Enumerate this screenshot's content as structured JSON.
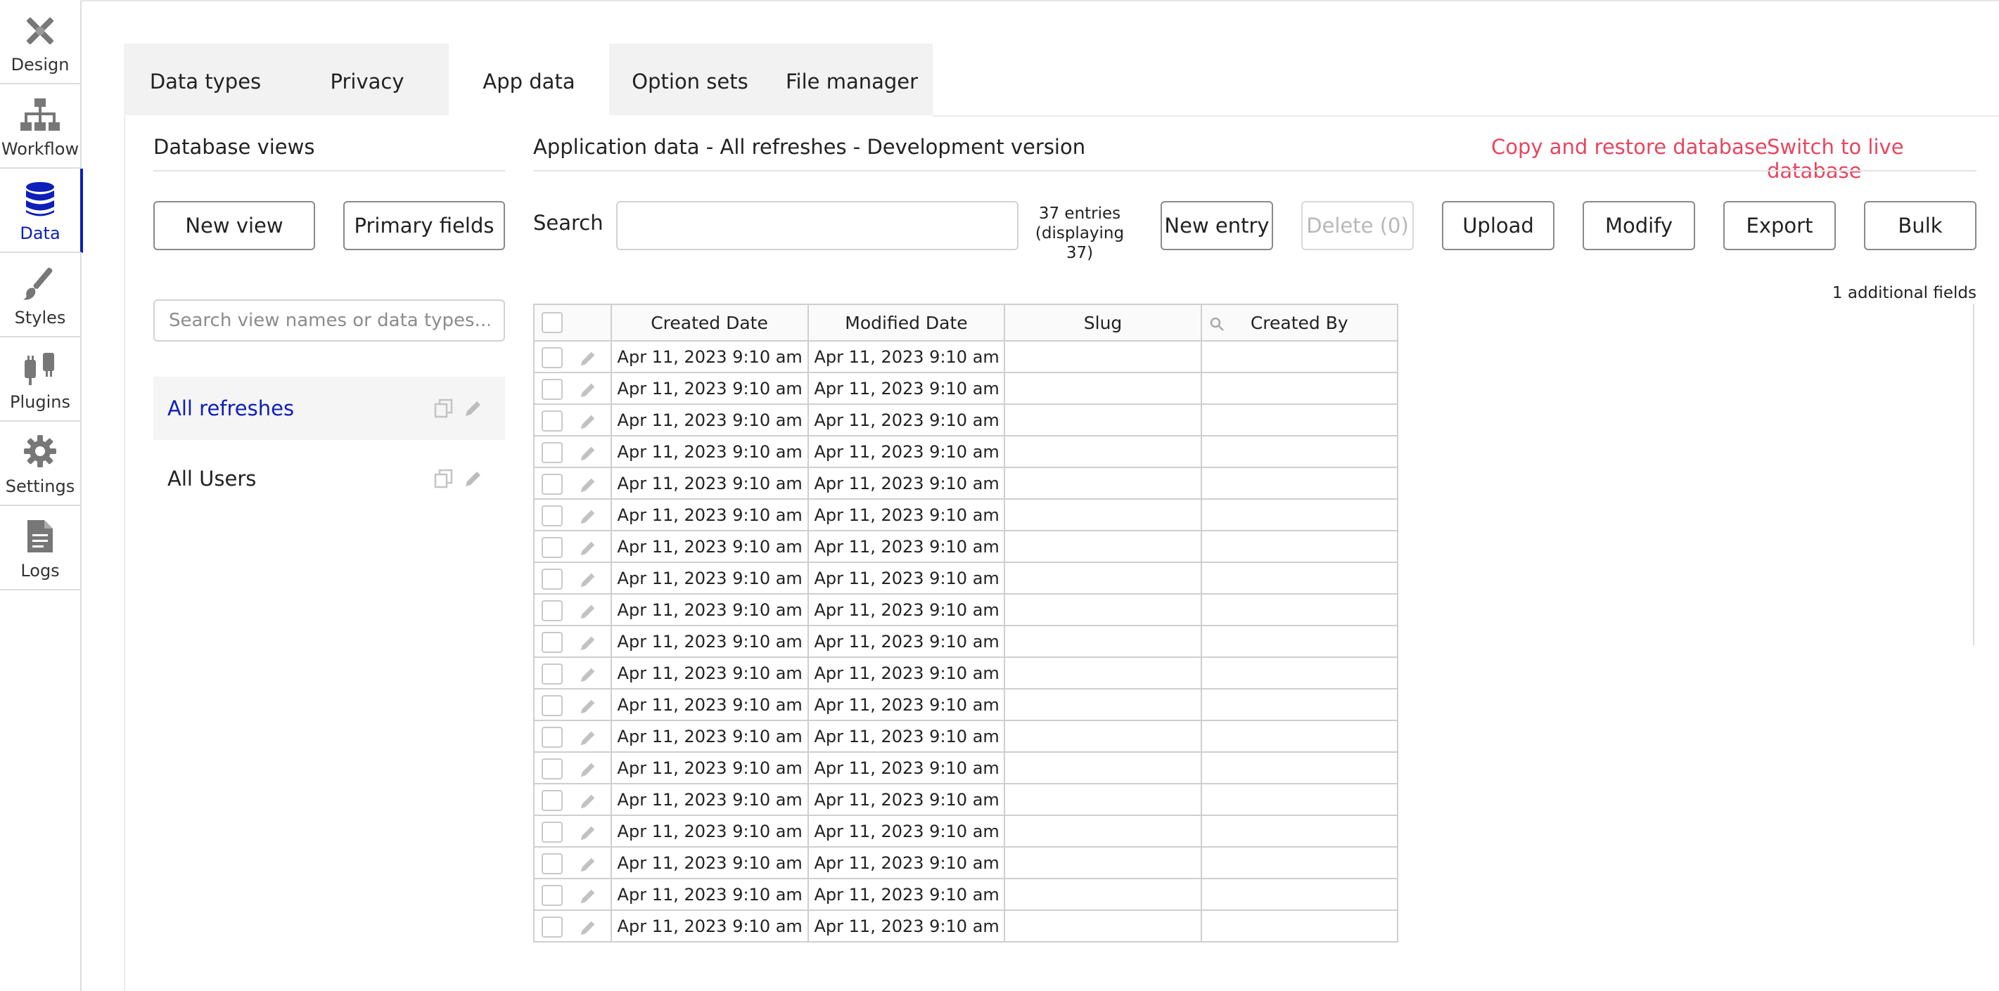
{
  "sidebar": {
    "items": [
      {
        "label": "Design",
        "icon": "design-icon",
        "active": false
      },
      {
        "label": "Workflow",
        "icon": "workflow-icon",
        "active": false
      },
      {
        "label": "Data",
        "icon": "database-icon",
        "active": true
      },
      {
        "label": "Styles",
        "icon": "brush-icon",
        "active": false
      },
      {
        "label": "Plugins",
        "icon": "plug-icon",
        "active": false
      },
      {
        "label": "Settings",
        "icon": "gear-icon",
        "active": false
      },
      {
        "label": "Logs",
        "icon": "document-icon",
        "active": false
      }
    ]
  },
  "tabs": [
    {
      "label": "Data types"
    },
    {
      "label": "Privacy"
    },
    {
      "label": "App data",
      "active": true
    },
    {
      "label": "Option sets"
    },
    {
      "label": "File manager"
    }
  ],
  "views_panel": {
    "title": "Database views",
    "new_view_label": "New view",
    "primary_fields_label": "Primary fields",
    "search_placeholder": "Search view names or data types...",
    "views": [
      {
        "name": "All refreshes",
        "active": true
      },
      {
        "name": "All Users",
        "active": false
      }
    ]
  },
  "app_data": {
    "title": "Application data - All refreshes - Development version",
    "copy_restore_label": "Copy and restore database",
    "switch_live_label": "Switch to live database",
    "search_label": "Search",
    "search_value": "",
    "entries_count": "37 entries",
    "entries_displaying": "(displaying 37)",
    "buttons": {
      "new_entry": "New entry",
      "delete": "Delete (0)",
      "upload": "Upload",
      "modify": "Modify",
      "export": "Export",
      "bulk": "Bulk"
    },
    "additional_fields": "1 additional fields"
  },
  "table": {
    "columns": [
      "Created Date",
      "Modified Date",
      "Slug",
      "Created By"
    ],
    "rows": [
      [
        "Apr 11, 2023 9:10 am",
        "Apr 11, 2023 9:10 am",
        "",
        ""
      ],
      [
        "Apr 11, 2023 9:10 am",
        "Apr 11, 2023 9:10 am",
        "",
        ""
      ],
      [
        "Apr 11, 2023 9:10 am",
        "Apr 11, 2023 9:10 am",
        "",
        ""
      ],
      [
        "Apr 11, 2023 9:10 am",
        "Apr 11, 2023 9:10 am",
        "",
        ""
      ],
      [
        "Apr 11, 2023 9:10 am",
        "Apr 11, 2023 9:10 am",
        "",
        ""
      ],
      [
        "Apr 11, 2023 9:10 am",
        "Apr 11, 2023 9:10 am",
        "",
        ""
      ],
      [
        "Apr 11, 2023 9:10 am",
        "Apr 11, 2023 9:10 am",
        "",
        ""
      ],
      [
        "Apr 11, 2023 9:10 am",
        "Apr 11, 2023 9:10 am",
        "",
        ""
      ],
      [
        "Apr 11, 2023 9:10 am",
        "Apr 11, 2023 9:10 am",
        "",
        ""
      ],
      [
        "Apr 11, 2023 9:10 am",
        "Apr 11, 2023 9:10 am",
        "",
        ""
      ],
      [
        "Apr 11, 2023 9:10 am",
        "Apr 11, 2023 9:10 am",
        "",
        ""
      ],
      [
        "Apr 11, 2023 9:10 am",
        "Apr 11, 2023 9:10 am",
        "",
        ""
      ],
      [
        "Apr 11, 2023 9:10 am",
        "Apr 11, 2023 9:10 am",
        "",
        ""
      ],
      [
        "Apr 11, 2023 9:10 am",
        "Apr 11, 2023 9:10 am",
        "",
        ""
      ],
      [
        "Apr 11, 2023 9:10 am",
        "Apr 11, 2023 9:10 am",
        "",
        ""
      ],
      [
        "Apr 11, 2023 9:10 am",
        "Apr 11, 2023 9:10 am",
        "",
        ""
      ],
      [
        "Apr 11, 2023 9:10 am",
        "Apr 11, 2023 9:10 am",
        "",
        ""
      ],
      [
        "Apr 11, 2023 9:10 am",
        "Apr 11, 2023 9:10 am",
        "",
        ""
      ],
      [
        "Apr 11, 2023 9:10 am",
        "Apr 11, 2023 9:10 am",
        "",
        ""
      ]
    ]
  },
  "colors": {
    "accent_blue": "#0d1fb8",
    "link_red": "#e8455f"
  }
}
